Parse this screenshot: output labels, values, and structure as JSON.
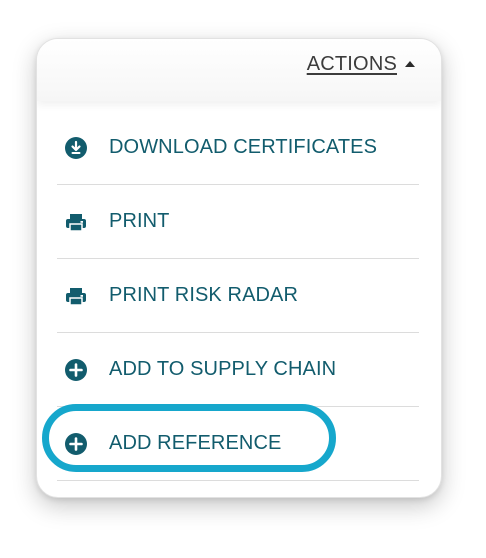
{
  "actions_menu": {
    "toggle_label": "ACTIONS",
    "toggle_icon": "caret-up-icon",
    "items": [
      {
        "label": "DOWNLOAD CERTIFICATES",
        "icon": "download-circle-icon"
      },
      {
        "label": "PRINT",
        "icon": "printer-icon"
      },
      {
        "label": "PRINT RISK RADAR",
        "icon": "printer-icon"
      },
      {
        "label": "ADD TO SUPPLY CHAIN",
        "icon": "plus-circle-icon"
      },
      {
        "label": "ADD REFERENCE",
        "icon": "plus-circle-icon",
        "highlighted": true
      }
    ]
  },
  "colors": {
    "item_text": "#125c6d",
    "icon": "#125c6d",
    "highlight_ring": "#16a7cc",
    "divider": "#dcdcdc"
  }
}
